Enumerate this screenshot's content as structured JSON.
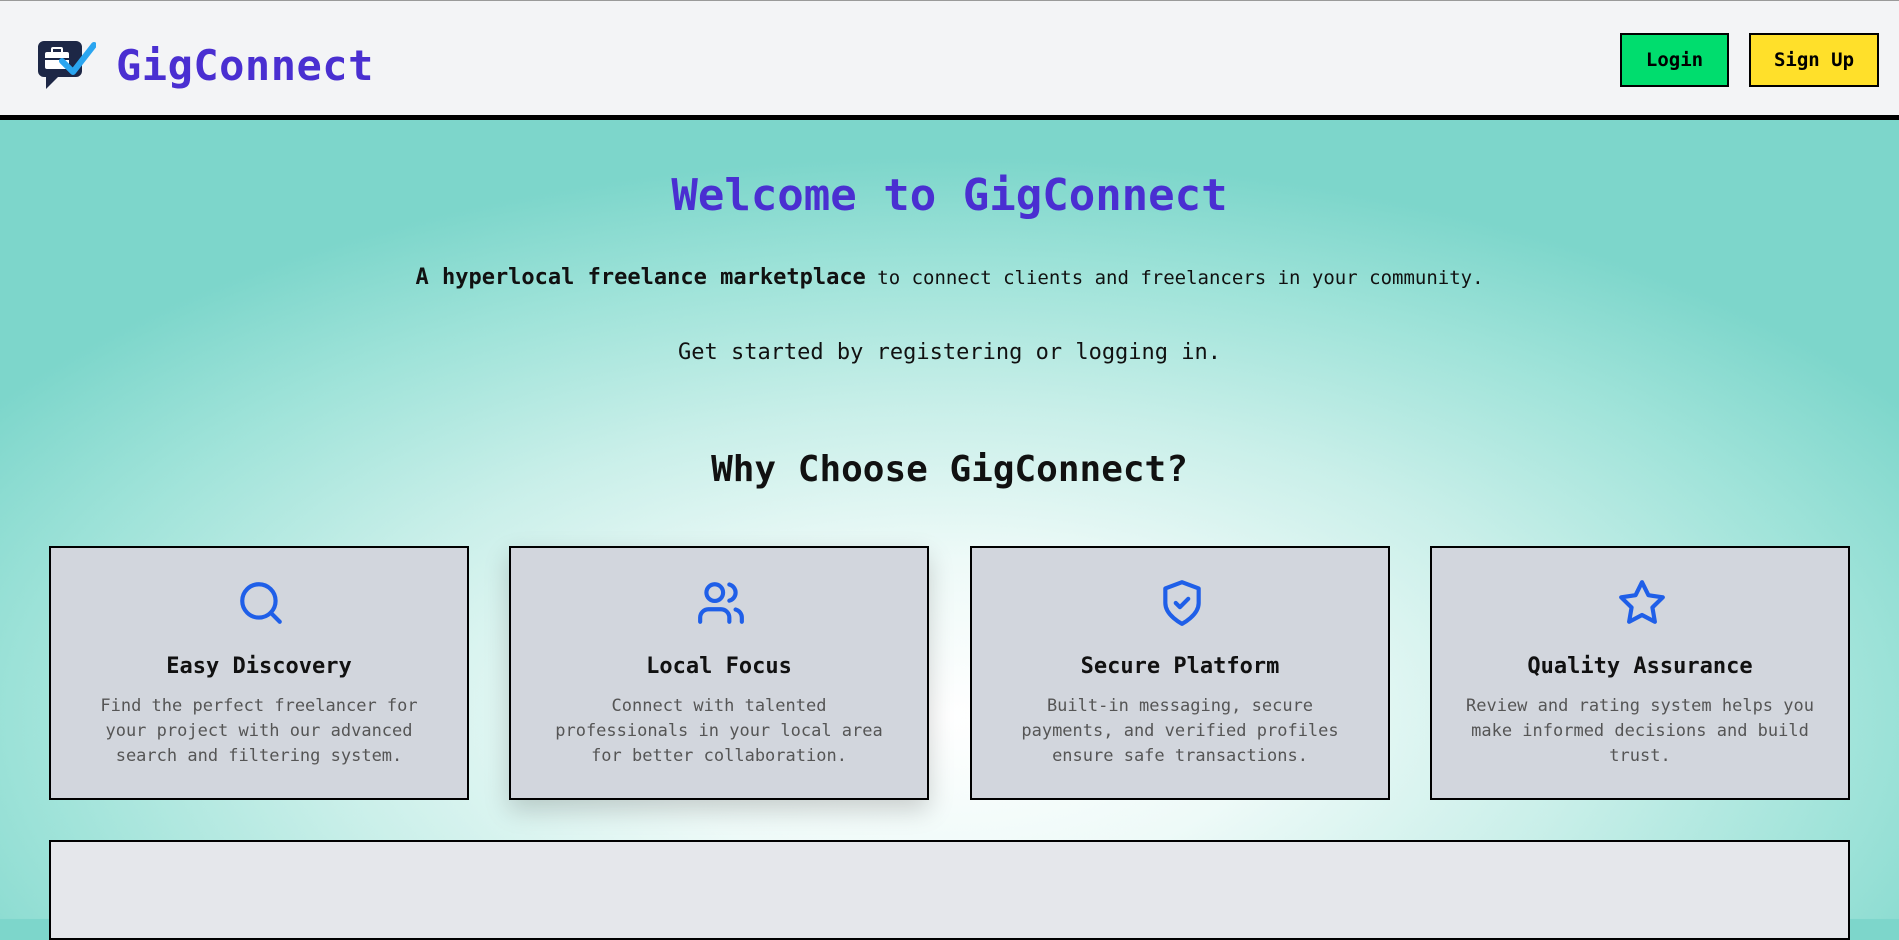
{
  "header": {
    "brand_name": "GigConnect",
    "logo_icon": "briefcase-check-chat-icon",
    "login_label": "Login",
    "signup_label": "Sign Up"
  },
  "hero": {
    "title": "Welcome to GigConnect",
    "tagline_bold": "A hyperlocal freelance marketplace",
    "tagline_rest": " to connect clients and freelancers in your community.",
    "cta": "Get started by registering or logging in."
  },
  "features": {
    "title": "Why Choose GigConnect?",
    "cards": [
      {
        "icon": "search-icon",
        "title": "Easy Discovery",
        "desc": "Find the perfect freelancer for your project with our advanced search and filtering system."
      },
      {
        "icon": "users-icon",
        "title": "Local Focus",
        "desc": "Connect with talented professionals in your local area for better collaboration."
      },
      {
        "icon": "shield-check-icon",
        "title": "Secure Platform",
        "desc": "Built-in messaging, secure payments, and verified profiles ensure safe transactions."
      },
      {
        "icon": "star-icon",
        "title": "Quality Assurance",
        "desc": "Review and rating system helps you make informed decisions and build trust."
      }
    ]
  },
  "colors": {
    "brand": "#4a2fd1",
    "login_bg": "#00dd6e",
    "signup_bg": "#ffe02a",
    "icon_blue": "#1f5fe8",
    "card_bg": "#d2d6dd"
  }
}
